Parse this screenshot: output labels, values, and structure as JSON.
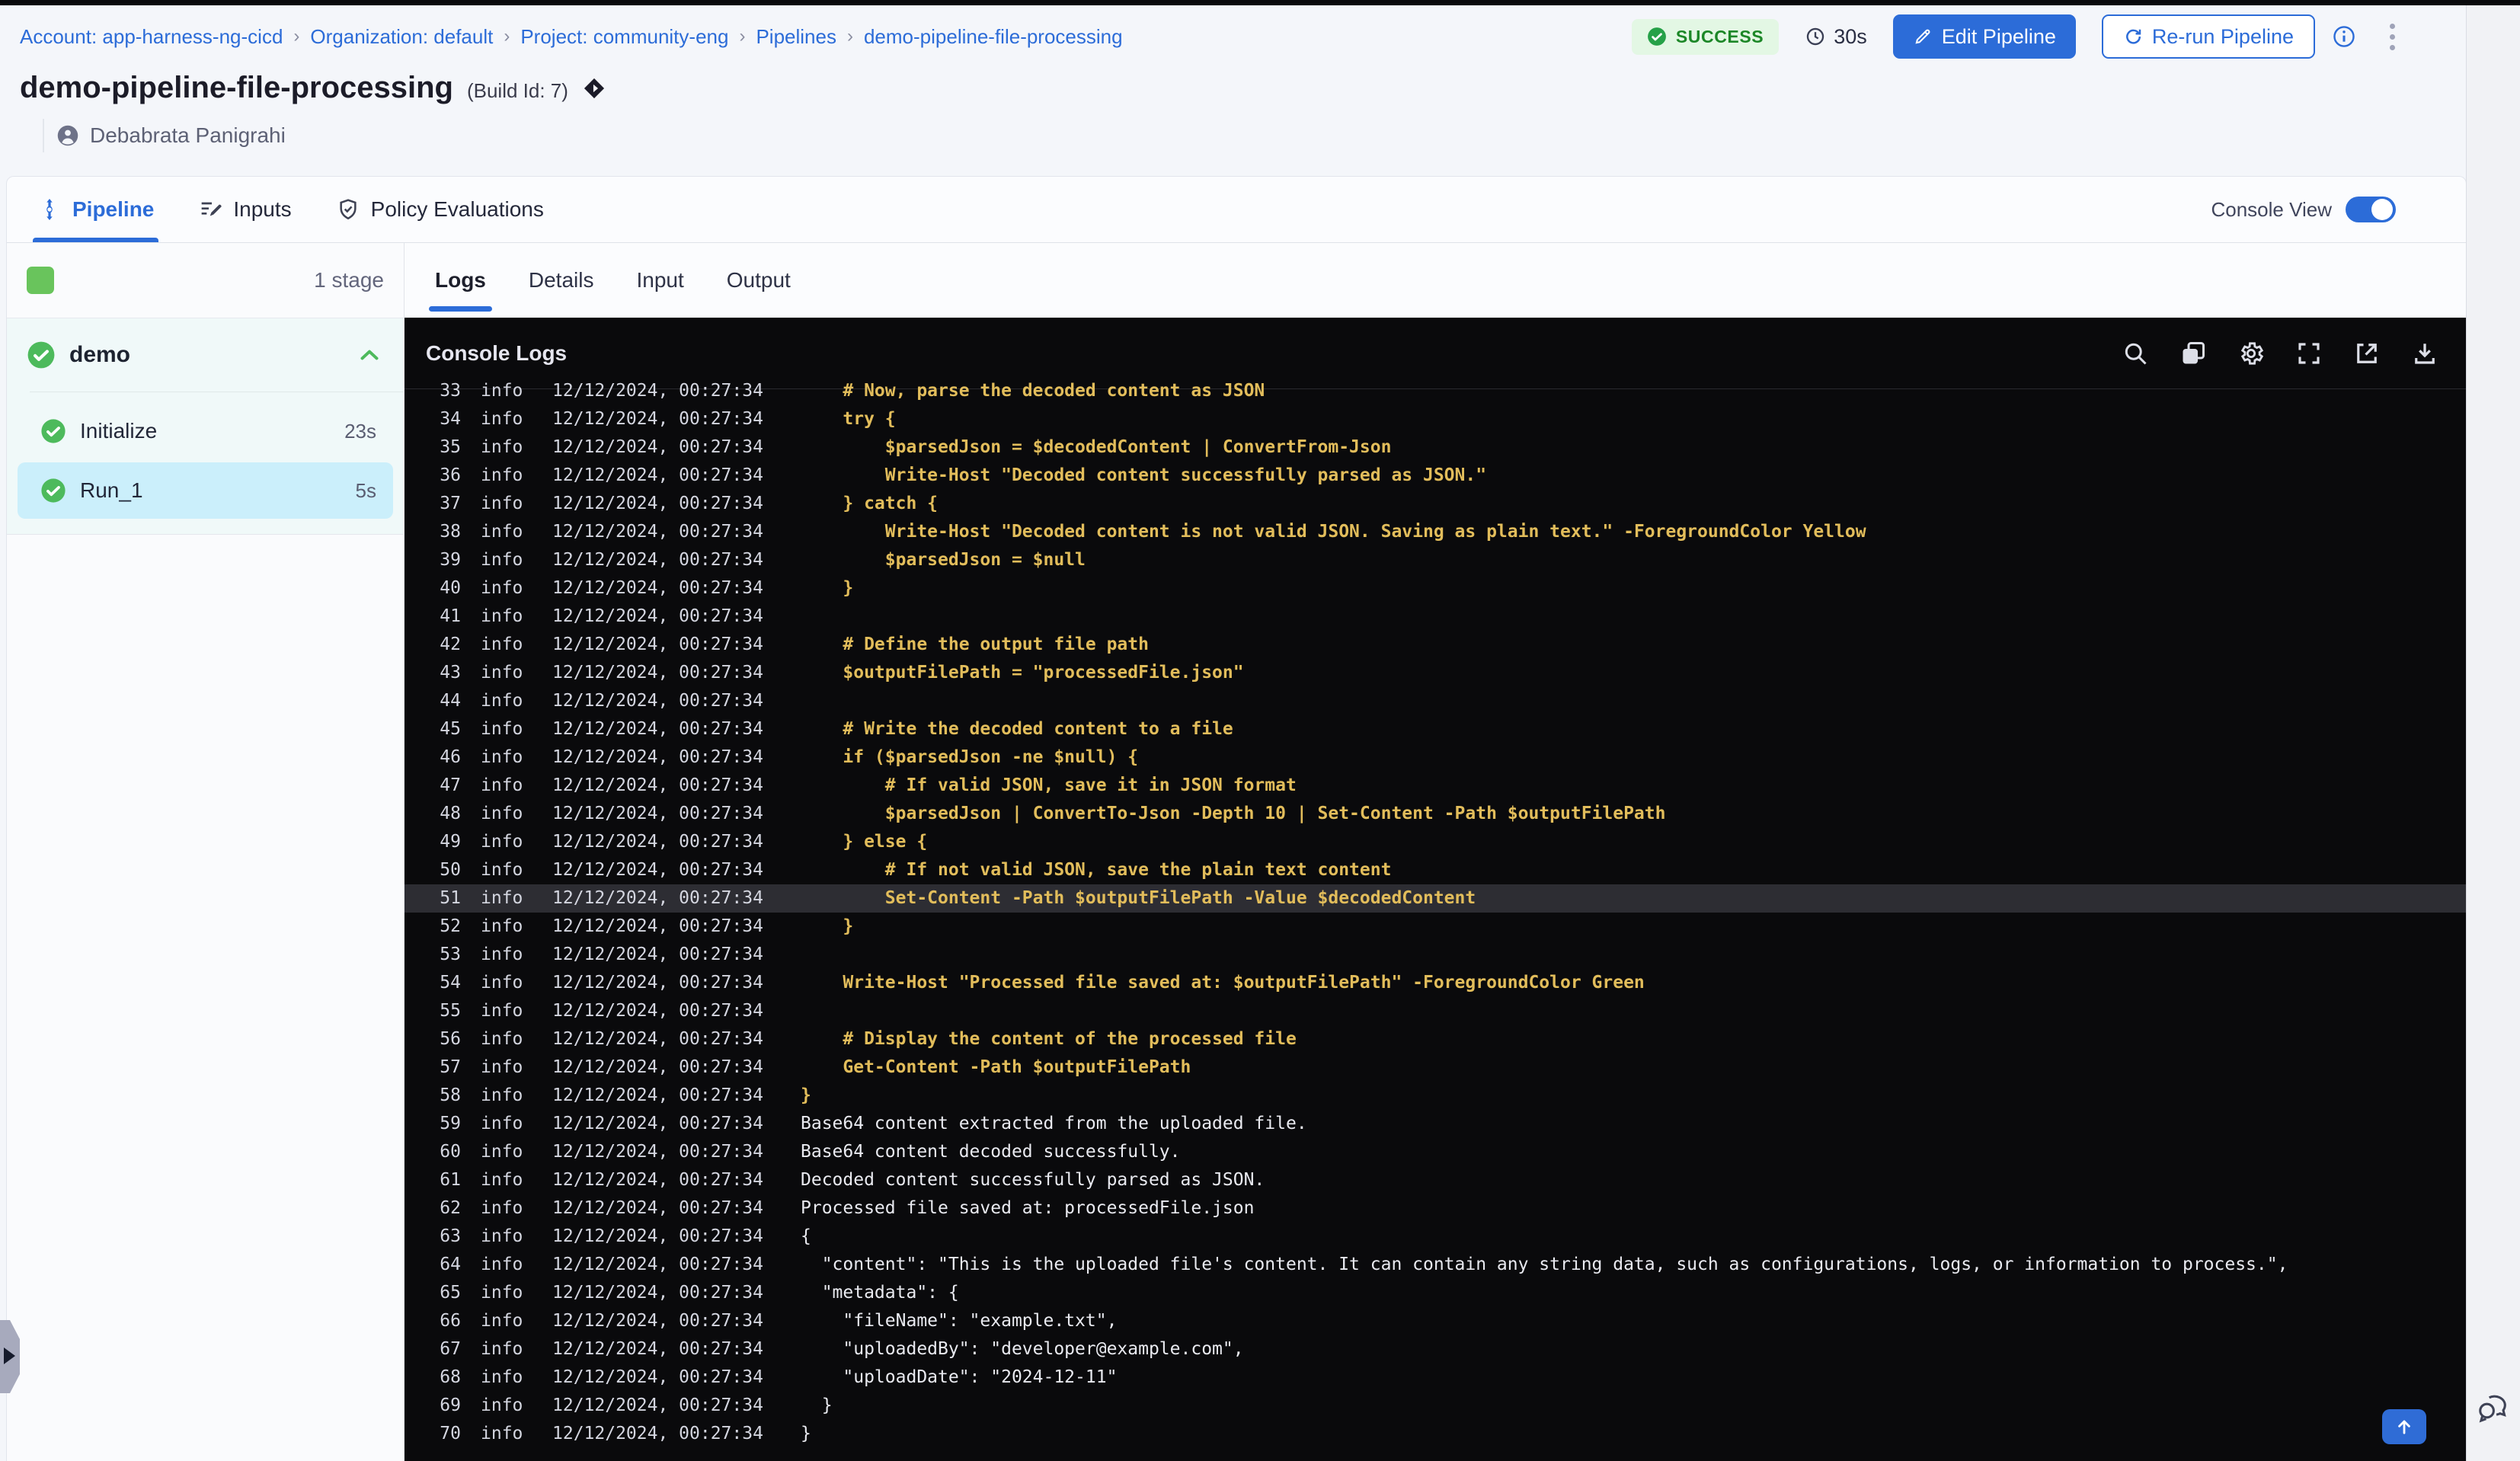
{
  "breadcrumb": {
    "separator": "›",
    "items": [
      {
        "label": "Account: app-harness-ng-cicd"
      },
      {
        "label": "Organization: default"
      },
      {
        "label": "Project: community-eng"
      },
      {
        "label": "Pipelines"
      },
      {
        "label": "demo-pipeline-file-processing"
      }
    ]
  },
  "header": {
    "title": "demo-pipeline-file-processing",
    "build_id": "(Build Id: 7)",
    "author": "Debabrata Panigrahi",
    "status": "SUCCESS",
    "duration": "30s",
    "edit_button": "Edit Pipeline",
    "rerun_button": "Re-run Pipeline"
  },
  "main_tabs": [
    {
      "label": "Pipeline",
      "icon": "pipeline-icon",
      "active": true
    },
    {
      "label": "Inputs",
      "icon": "inputs-icon",
      "active": false
    },
    {
      "label": "Policy Evaluations",
      "icon": "policy-icon",
      "active": false
    }
  ],
  "console_view": {
    "label": "Console View",
    "enabled": true
  },
  "sidebar": {
    "stage_count": "1 stage",
    "group": {
      "name": "demo",
      "status": "success"
    },
    "steps": [
      {
        "name": "Initialize",
        "duration": "23s",
        "selected": false
      },
      {
        "name": "Run_1",
        "duration": "5s",
        "selected": true
      }
    ]
  },
  "console": {
    "tabs": [
      {
        "label": "Logs",
        "active": true
      },
      {
        "label": "Details",
        "active": false
      },
      {
        "label": "Input",
        "active": false
      },
      {
        "label": "Output",
        "active": false
      }
    ],
    "title": "Console Logs",
    "toolbar_icons": [
      "search-icon",
      "copy-icon",
      "settings-icon",
      "fullscreen-icon",
      "open-in-new-icon",
      "download-icon"
    ]
  },
  "logs": {
    "level": "info",
    "timestamp": "12/12/2024, 00:27:34",
    "lines": [
      {
        "n": 33,
        "kind": "code",
        "text": "    # Now, parse the decoded content as JSON"
      },
      {
        "n": 34,
        "kind": "code",
        "text": "    try {"
      },
      {
        "n": 35,
        "kind": "code",
        "text": "        $parsedJson = $decodedContent | ConvertFrom-Json"
      },
      {
        "n": 36,
        "kind": "code",
        "text": "        Write-Host \"Decoded content successfully parsed as JSON.\""
      },
      {
        "n": 37,
        "kind": "code",
        "text": "    } catch {"
      },
      {
        "n": 38,
        "kind": "code",
        "text": "        Write-Host \"Decoded content is not valid JSON. Saving as plain text.\" -ForegroundColor Yellow"
      },
      {
        "n": 39,
        "kind": "code",
        "text": "        $parsedJson = $null"
      },
      {
        "n": 40,
        "kind": "code",
        "text": "    }"
      },
      {
        "n": 41,
        "kind": "code",
        "text": ""
      },
      {
        "n": 42,
        "kind": "code",
        "text": "    # Define the output file path"
      },
      {
        "n": 43,
        "kind": "code",
        "text": "    $outputFilePath = \"processedFile.json\""
      },
      {
        "n": 44,
        "kind": "code",
        "text": ""
      },
      {
        "n": 45,
        "kind": "code",
        "text": "    # Write the decoded content to a file"
      },
      {
        "n": 46,
        "kind": "code",
        "text": "    if ($parsedJson -ne $null) {"
      },
      {
        "n": 47,
        "kind": "code",
        "text": "        # If valid JSON, save it in JSON format"
      },
      {
        "n": 48,
        "kind": "code",
        "text": "        $parsedJson | ConvertTo-Json -Depth 10 | Set-Content -Path $outputFilePath"
      },
      {
        "n": 49,
        "kind": "code",
        "text": "    } else {"
      },
      {
        "n": 50,
        "kind": "code",
        "text": "        # If not valid JSON, save the plain text content"
      },
      {
        "n": 51,
        "kind": "code",
        "highlight": true,
        "text": "        Set-Content -Path $outputFilePath -Value $decodedContent"
      },
      {
        "n": 52,
        "kind": "code",
        "text": "    }"
      },
      {
        "n": 53,
        "kind": "code",
        "text": ""
      },
      {
        "n": 54,
        "kind": "code",
        "text": "    Write-Host \"Processed file saved at: $outputFilePath\" -ForegroundColor Green"
      },
      {
        "n": 55,
        "kind": "code",
        "text": ""
      },
      {
        "n": 56,
        "kind": "code",
        "text": "    # Display the content of the processed file"
      },
      {
        "n": 57,
        "kind": "code",
        "text": "    Get-Content -Path $outputFilePath"
      },
      {
        "n": 58,
        "kind": "code",
        "text": "}"
      },
      {
        "n": 59,
        "kind": "output",
        "text": "Base64 content extracted from the uploaded file."
      },
      {
        "n": 60,
        "kind": "output",
        "text": "Base64 content decoded successfully."
      },
      {
        "n": 61,
        "kind": "output",
        "text": "Decoded content successfully parsed as JSON."
      },
      {
        "n": 62,
        "kind": "output",
        "text": "Processed file saved at: processedFile.json"
      },
      {
        "n": 63,
        "kind": "output",
        "text": "{"
      },
      {
        "n": 64,
        "kind": "output",
        "text": "  \"content\": \"This is the uploaded file's content. It can contain any string data, such as configurations, logs, or information to process.\","
      },
      {
        "n": 65,
        "kind": "output",
        "text": "  \"metadata\": {"
      },
      {
        "n": 66,
        "kind": "output",
        "text": "    \"fileName\": \"example.txt\","
      },
      {
        "n": 67,
        "kind": "output",
        "text": "    \"uploadedBy\": \"developer@example.com\","
      },
      {
        "n": 68,
        "kind": "output",
        "text": "    \"uploadDate\": \"2024-12-11\""
      },
      {
        "n": 69,
        "kind": "output",
        "text": "  }"
      },
      {
        "n": 70,
        "kind": "output",
        "text": "}"
      }
    ]
  },
  "colors": {
    "primary_blue": "#2C6CD8",
    "success_green": "#4DBA5C",
    "badge_bg": "#E3F7E4",
    "badge_text": "#1C8727",
    "console_bg": "#0A0A0C",
    "log_code_yellow": "#E2BD5B",
    "log_output_white": "#E9EAF0",
    "selected_step_bg": "#CBEFFB"
  }
}
